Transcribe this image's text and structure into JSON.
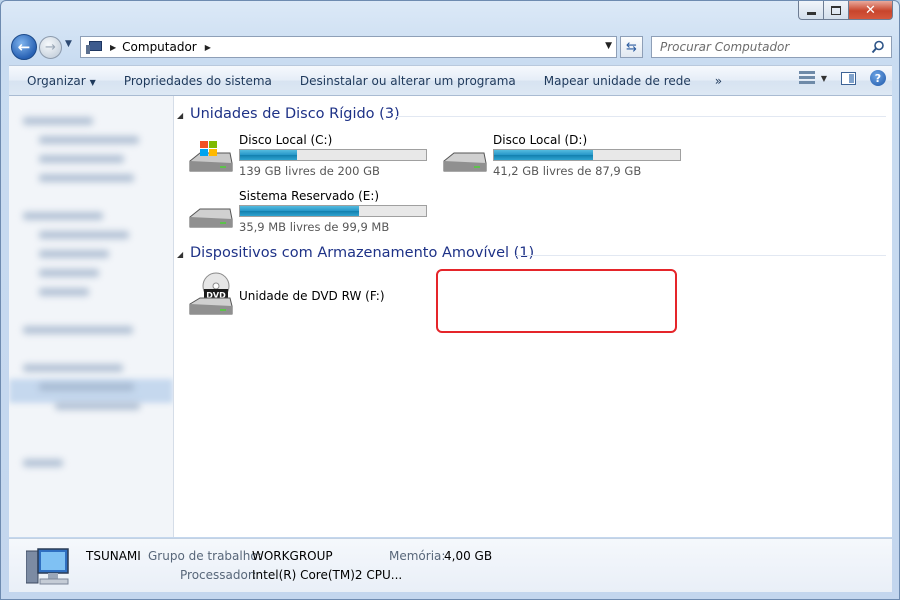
{
  "window": {
    "close_glyph": "✕"
  },
  "nav": {
    "back_glyph": "←",
    "forward_glyph": "→",
    "address": "Computador",
    "search_placeholder": "Procurar Computador"
  },
  "toolbar": {
    "organize": "Organizar",
    "system_properties": "Propriedades do sistema",
    "uninstall": "Desinstalar ou alterar um programa",
    "map_drive": "Mapear unidade de rede",
    "more": "»"
  },
  "groups": {
    "hdd": {
      "title": "Unidades de Disco Rígido (3)",
      "drives": [
        {
          "name": "Disco Local (C:)",
          "free": "139 GB livres de 200 GB",
          "used_fraction": 0.305
        },
        {
          "name": "Disco Local (D:)",
          "free": "41,2 GB livres de 87,9 GB",
          "used_fraction": 0.53
        },
        {
          "name": "Sistema Reservado (E:)",
          "free": "35,9 MB livres de 99,9 MB",
          "used_fraction": 0.64
        }
      ]
    },
    "removable": {
      "title": "Dispositivos com Armazenamento Amovível (1)",
      "drives": [
        {
          "name": "Unidade de DVD RW (F:)",
          "icon_label": "DVD"
        }
      ]
    }
  },
  "details": {
    "computer_name": "TSUNAMI",
    "workgroup_label": "Grupo de trabalho:",
    "workgroup_value": "WORKGROUP",
    "memory_label": "Memória:",
    "memory_value": "4,00 GB",
    "processor_label": "Processador:",
    "processor_value": "Intel(R) Core(TM)2 CPU..."
  },
  "colors": {
    "group_title": "#1e3287",
    "bar_fill": "#2696c8",
    "highlight": "#e5252a"
  }
}
